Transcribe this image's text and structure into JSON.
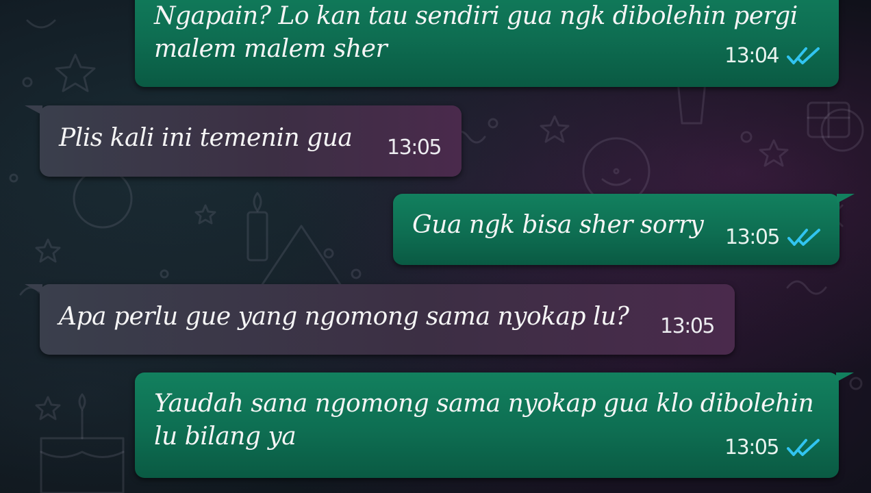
{
  "theme": {
    "outgoing_bubble": "#0e6e52",
    "incoming_bubble": "#3c2f44",
    "read_tick_color": "#31c4f0",
    "text_color": "#f5f5f5"
  },
  "messages": [
    {
      "direction": "outgoing",
      "text": "Ngapain? Lo kan tau sendiri gua ngk dibolehin pergi\nmalem malem sher",
      "time": "13:04",
      "status_icon": "double-check-read-icon"
    },
    {
      "direction": "incoming",
      "text": "Plis kali ini temenin gua",
      "time": "13:05"
    },
    {
      "direction": "outgoing",
      "text": "Gua ngk bisa sher sorry",
      "time": "13:05",
      "status_icon": "double-check-read-icon"
    },
    {
      "direction": "incoming",
      "text": "Apa perlu gue yang ngomong sama nyokap lu?",
      "time": "13:05"
    },
    {
      "direction": "outgoing",
      "text": "Yaudah sana ngomong sama nyokap gua klo dibolehin\nlu bilang ya",
      "time": "13:05",
      "status_icon": "double-check-read-icon"
    }
  ]
}
